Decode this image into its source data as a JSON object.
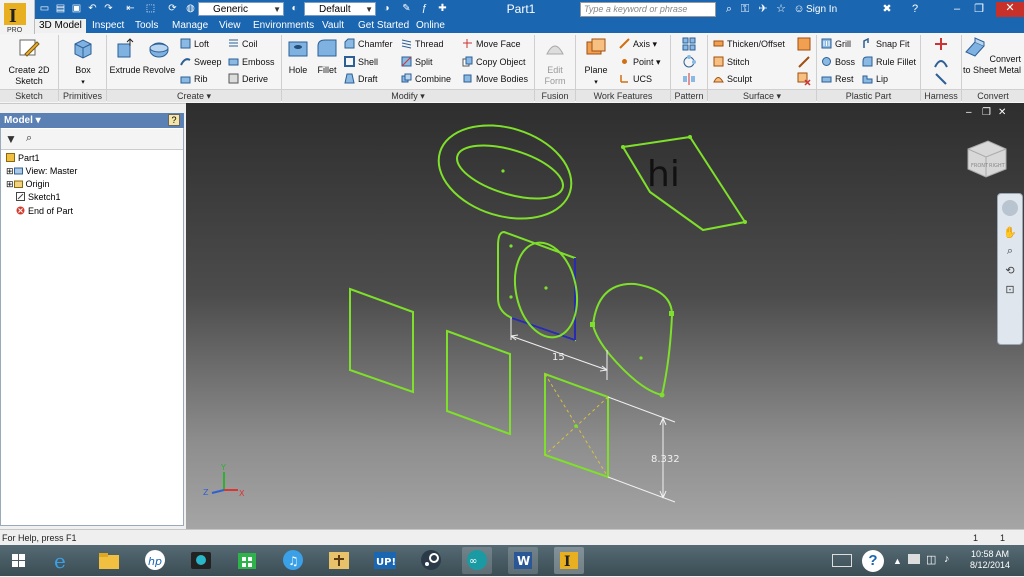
{
  "app": {
    "document_title": "Part1",
    "style_combo": "Generic",
    "material_combo": "Default",
    "search_placeholder": "Type a keyword or phrase",
    "sign_in": "Sign In",
    "logo_badge": "PRO"
  },
  "menu_tabs": [
    "3D Model",
    "Inspect",
    "Tools",
    "Manage",
    "View",
    "Environments",
    "Vault",
    "Get Started",
    "Online"
  ],
  "active_tab": "3D Model",
  "ribbon": {
    "sketch": {
      "label": "Sketch",
      "create_2d": "Create 2D Sketch"
    },
    "primitives": {
      "label": "Primitives",
      "box": "Box"
    },
    "create": {
      "label": "Create",
      "extrude": "Extrude",
      "revolve": "Revolve",
      "loft": "Loft",
      "sweep": "Sweep",
      "rib": "Rib",
      "coil": "Coil",
      "emboss": "Emboss",
      "derive": "Derive"
    },
    "modify": {
      "label": "Modify",
      "hole": "Hole",
      "fillet": "Fillet",
      "chamfer": "Chamfer",
      "shell": "Shell",
      "draft": "Draft",
      "thread": "Thread",
      "split": "Split",
      "combine": "Combine",
      "move_face": "Move Face",
      "copy_object": "Copy Object",
      "move_bodies": "Move Bodies"
    },
    "fusion": {
      "label": "Fusion",
      "edit_form": "Edit Form"
    },
    "work_features": {
      "label": "Work Features",
      "plane": "Plane",
      "axis": "Axis",
      "point": "Point",
      "ucs": "UCS"
    },
    "pattern": {
      "label": "Pattern"
    },
    "surface": {
      "label": "Surface",
      "thicken": "Thicken/Offset",
      "stitch": "Stitch",
      "sculpt": "Sculpt"
    },
    "plastic_part": {
      "label": "Plastic Part",
      "grill": "Grill",
      "boss": "Boss",
      "rest": "Rest",
      "snap_fit": "Snap Fit",
      "rule_fillet": "Rule Fillet",
      "lip": "Lip"
    },
    "harness": {
      "label": "Harness"
    },
    "convert": {
      "label": "Convert",
      "convert_sheet_metal": "Convert to Sheet Metal"
    }
  },
  "browser": {
    "title": "Model",
    "help": "?",
    "items": [
      {
        "label": "Part1"
      },
      {
        "label": "View: Master"
      },
      {
        "label": "Origin"
      },
      {
        "label": "Sketch1"
      },
      {
        "label": "End of Part"
      }
    ]
  },
  "viewport": {
    "sketch_text": "hi",
    "dim_horizontal": "15",
    "dim_vertical": "8.332",
    "viewcube_faces": [
      "FRONT",
      "RIGHT"
    ],
    "axis_labels": [
      "Y",
      "Z",
      "X"
    ]
  },
  "status": {
    "help_text": "For Help, press F1",
    "count_a": "1",
    "count_b": "1"
  },
  "taskbar": {
    "time": "10:58 AM",
    "date": "8/12/2014",
    "upload_label": "UP!"
  },
  "colors": {
    "titlebar": "#1b66b0",
    "sketch_green": "#7ee02a",
    "constraint_blue": "#2a2ab0",
    "dimension_white": "#f0f0f0"
  }
}
